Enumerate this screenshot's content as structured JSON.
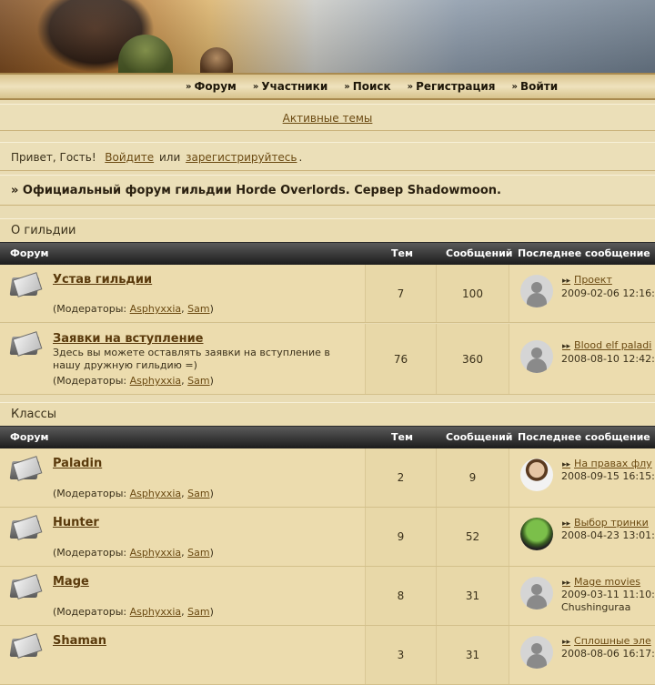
{
  "nav": {
    "items": [
      {
        "label": "Форум"
      },
      {
        "label": "Участники"
      },
      {
        "label": "Поиск"
      },
      {
        "label": "Регистрация"
      },
      {
        "label": "Войти"
      }
    ]
  },
  "active_topics": "Активные темы",
  "greeting": {
    "text": "Привет, Гость!",
    "login_link": "Войдите",
    "or": "или",
    "register_link": "зарегистрируйтесь",
    "period": "."
  },
  "forum_title": "» Официальный форум гильдии Horde Overlords. Сервер Shadowmoon.",
  "columns": {
    "forum": "Форум",
    "topics": "Тем",
    "posts": "Сообщений",
    "last": "Последнее сообщение"
  },
  "mods_label": "(Модераторы:",
  "mod1": "Asphyxxia",
  "mod2": "Sam",
  "categories": [
    {
      "title": "О гильдии",
      "forums": [
        {
          "name": "Устав гильдии",
          "desc": "",
          "topics": "7",
          "posts": "100",
          "last_topic": "Проект",
          "last_date": "2009-02-06 12:16:",
          "last_user": "",
          "avatar": "default"
        },
        {
          "name": "Заявки на вступление",
          "desc": "Здесь вы можете оставлять заявки на вступление в нашу дружную гильдию =)",
          "topics": "76",
          "posts": "360",
          "last_topic": "Blood elf paladi",
          "last_date": "2008-08-10 12:42:",
          "last_user": "",
          "avatar": "default"
        }
      ]
    },
    {
      "title": "Классы",
      "forums": [
        {
          "name": "Paladin",
          "desc": "",
          "topics": "2",
          "posts": "9",
          "last_topic": "На правах флу",
          "last_date": "2008-09-15 16:15:",
          "last_user": "",
          "avatar": "photo"
        },
        {
          "name": "Hunter",
          "desc": "",
          "topics": "9",
          "posts": "52",
          "last_topic": "Выбор тринки",
          "last_date": "2008-04-23 13:01:",
          "last_user": "",
          "avatar": "green"
        },
        {
          "name": "Mage",
          "desc": "",
          "topics": "8",
          "posts": "31",
          "last_topic": "Mage movies",
          "last_date": "2009-03-11 11:10:",
          "last_user": "Chushinguraa",
          "avatar": "default"
        },
        {
          "name": "Shaman",
          "desc": "",
          "topics": "3",
          "posts": "31",
          "last_topic": "Сплошные эле",
          "last_date": "2008-08-06 16:17:",
          "last_user": "",
          "avatar": "default"
        }
      ]
    }
  ],
  "colors": {
    "background": "#e9dcb4",
    "header_bar": "#1c1c1c",
    "link": "#6b4a12"
  }
}
